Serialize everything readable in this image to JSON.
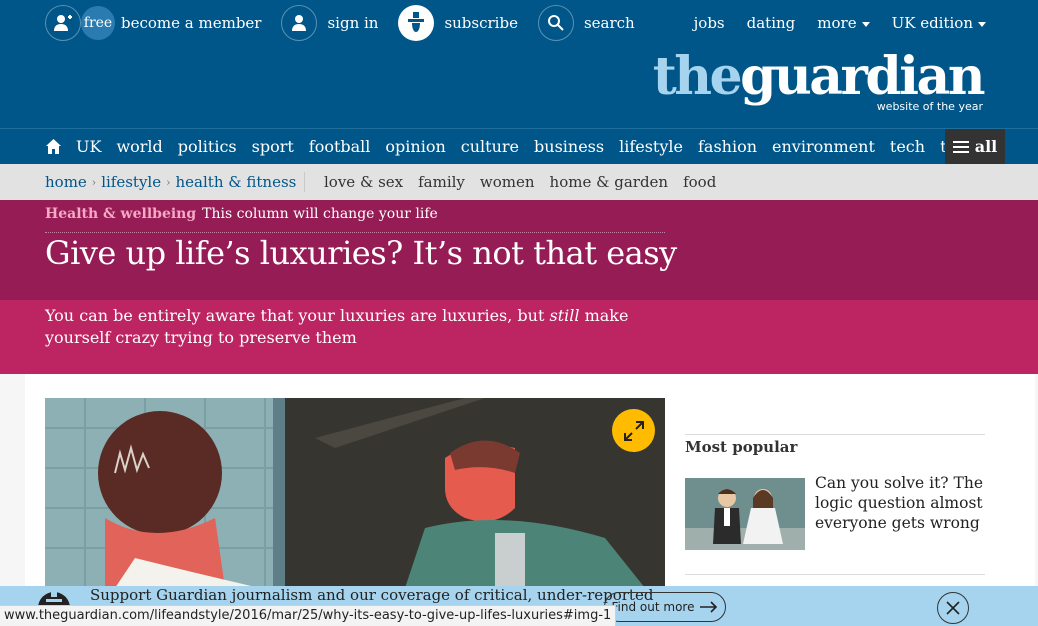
{
  "topnav": {
    "free_badge": "free",
    "member": "become a member",
    "signin": "sign in",
    "subscribe": "subscribe",
    "search": "search",
    "jobs": "jobs",
    "dating": "dating",
    "more": "more",
    "edition": "UK edition"
  },
  "logo": {
    "the": "the",
    "guardian": "guardian",
    "tagline": "website of the year"
  },
  "sections": [
    "UK",
    "world",
    "politics",
    "sport",
    "football",
    "opinion",
    "culture",
    "business",
    "lifestyle",
    "fashion",
    "environment",
    "tech",
    "travel"
  ],
  "all_label": "all",
  "breadcrumbs": [
    "home",
    "lifestyle",
    "health & fitness"
  ],
  "subsections": [
    "love & sex",
    "family",
    "women",
    "home & garden",
    "food"
  ],
  "article": {
    "section": "Health & wellbeing",
    "series": "This column will change your life",
    "headline": "Give up life’s luxuries? It’s not that easy",
    "standfirst_a": "You can be entirely aware that your luxuries are luxuries, but ",
    "standfirst_em": "still",
    "standfirst_b": " make yourself crazy trying to preserve them"
  },
  "most_popular": {
    "title": "Most popular",
    "items": [
      {
        "headline": "Can you solve it? The logic question almost everyone gets wrong"
      }
    ]
  },
  "support": {
    "text": "Support Guardian journalism and our coverage of critical, under-reported",
    "button": "Find out more"
  },
  "status_url": "www.theguardian.com/lifeandstyle/2016/mar/25/why-its-easy-to-give-up-lifes-luxuries#img-1",
  "colors": {
    "brand_blue": "#005689",
    "headline_band": "#951c55",
    "standfirst_band": "#bd2462",
    "support_band": "#a6d4ee",
    "expand_yellow": "#ffbb00"
  }
}
